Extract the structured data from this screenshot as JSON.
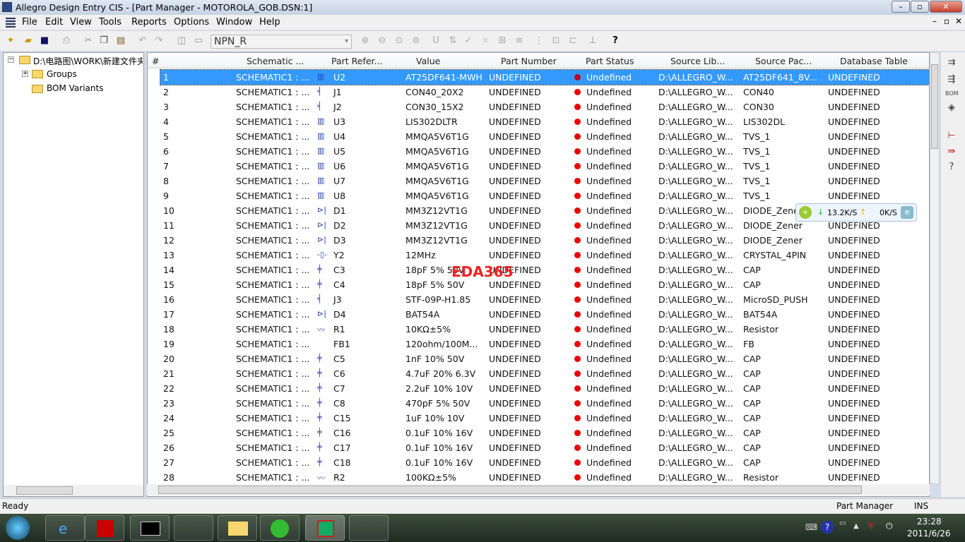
{
  "window": {
    "title": "Allegro Design Entry CIS - [Part Manager - MOTOROLA_GOB.DSN:1]"
  },
  "menu": [
    "File",
    "Edit",
    "View",
    "Tools",
    "Reports",
    "Options",
    "Window",
    "Help"
  ],
  "toolbar": {
    "combo_value": "NPN_R"
  },
  "tree": {
    "root": "D:\\电路图\\WORK\\新建文件夹",
    "children": [
      "Groups",
      "BOM Variants"
    ]
  },
  "columns": [
    "#",
    "Schematic ...",
    "Part Refer...",
    "Value",
    "Part Number",
    "Part Status",
    "Source Lib...",
    "Source Pac...",
    "Database Table"
  ],
  "rows": [
    [
      "1",
      "SCHEMATIC1 : ...",
      "ic",
      "U2",
      "AT25DF641-MWH",
      "UNDEFINED",
      "Undefined",
      "D:\\ALLEGRO_W...",
      "AT25DF641_8V...",
      "UNDEFINED"
    ],
    [
      "2",
      "SCHEMATIC1 : ...",
      "conn",
      "J1",
      "CON40_20X2",
      "UNDEFINED",
      "Undefined",
      "D:\\ALLEGRO_W...",
      "CON40",
      "UNDEFINED"
    ],
    [
      "3",
      "SCHEMATIC1 : ...",
      "conn",
      "J2",
      "CON30_15X2",
      "UNDEFINED",
      "Undefined",
      "D:\\ALLEGRO_W...",
      "CON30",
      "UNDEFINED"
    ],
    [
      "4",
      "SCHEMATIC1 : ...",
      "ic",
      "U3",
      "LIS302DLTR",
      "UNDEFINED",
      "Undefined",
      "D:\\ALLEGRO_W...",
      "LIS302DL",
      "UNDEFINED"
    ],
    [
      "5",
      "SCHEMATIC1 : ...",
      "ic",
      "U4",
      "MMQA5V6T1G",
      "UNDEFINED",
      "Undefined",
      "D:\\ALLEGRO_W...",
      "TVS_1",
      "UNDEFINED"
    ],
    [
      "6",
      "SCHEMATIC1 : ...",
      "ic",
      "U5",
      "MMQA5V6T1G",
      "UNDEFINED",
      "Undefined",
      "D:\\ALLEGRO_W...",
      "TVS_1",
      "UNDEFINED"
    ],
    [
      "7",
      "SCHEMATIC1 : ...",
      "ic",
      "U6",
      "MMQA5V6T1G",
      "UNDEFINED",
      "Undefined",
      "D:\\ALLEGRO_W...",
      "TVS_1",
      "UNDEFINED"
    ],
    [
      "8",
      "SCHEMATIC1 : ...",
      "ic",
      "U7",
      "MMQA5V6T1G",
      "UNDEFINED",
      "Undefined",
      "D:\\ALLEGRO_W...",
      "TVS_1",
      "UNDEFINED"
    ],
    [
      "9",
      "SCHEMATIC1 : ...",
      "ic",
      "U8",
      "MMQA5V6T1G",
      "UNDEFINED",
      "Undefined",
      "D:\\ALLEGRO_W...",
      "TVS_1",
      "UNDEFINED"
    ],
    [
      "10",
      "SCHEMATIC1 : ...",
      "diode",
      "D1",
      "MM3Z12VT1G",
      "UNDEFINED",
      "Undefined",
      "D:\\ALLEGRO_W...",
      "DIODE_Zener",
      "UNDEFINED"
    ],
    [
      "11",
      "SCHEMATIC1 : ...",
      "diode",
      "D2",
      "MM3Z12VT1G",
      "UNDEFINED",
      "Undefined",
      "D:\\ALLEGRO_W...",
      "DIODE_Zener",
      "UNDEFINED"
    ],
    [
      "12",
      "SCHEMATIC1 : ...",
      "diode",
      "D3",
      "MM3Z12VT1G",
      "UNDEFINED",
      "Undefined",
      "D:\\ALLEGRO_W...",
      "DIODE_Zener",
      "UNDEFINED"
    ],
    [
      "13",
      "SCHEMATIC1 : ...",
      "crystal",
      "Y2",
      "12MHz",
      "UNDEFINED",
      "Undefined",
      "D:\\ALLEGRO_W...",
      "CRYSTAL_4PIN",
      "UNDEFINED"
    ],
    [
      "14",
      "SCHEMATIC1 : ...",
      "cap",
      "C3",
      "18pF 5% 50V",
      "UNDEFINED",
      "Undefined",
      "D:\\ALLEGRO_W...",
      "CAP",
      "UNDEFINED"
    ],
    [
      "15",
      "SCHEMATIC1 : ...",
      "cap",
      "C4",
      "18pF 5% 50V",
      "UNDEFINED",
      "Undefined",
      "D:\\ALLEGRO_W...",
      "CAP",
      "UNDEFINED"
    ],
    [
      "16",
      "SCHEMATIC1 : ...",
      "conn",
      "J3",
      "STF-09P-H1.85",
      "UNDEFINED",
      "Undefined",
      "D:\\ALLEGRO_W...",
      "MicroSD_PUSH",
      "UNDEFINED"
    ],
    [
      "17",
      "SCHEMATIC1 : ...",
      "diode",
      "D4",
      "BAT54A",
      "UNDEFINED",
      "Undefined",
      "D:\\ALLEGRO_W...",
      "BAT54A",
      "UNDEFINED"
    ],
    [
      "18",
      "SCHEMATIC1 : ...",
      "res",
      "R1",
      "10KΩ±5%",
      "UNDEFINED",
      "Undefined",
      "D:\\ALLEGRO_W...",
      "Resistor",
      "UNDEFINED"
    ],
    [
      "19",
      "SCHEMATIC1 : ...",
      "none",
      "FB1",
      "120ohm/100M...",
      "UNDEFINED",
      "Undefined",
      "D:\\ALLEGRO_W...",
      "FB",
      "UNDEFINED"
    ],
    [
      "20",
      "SCHEMATIC1 : ...",
      "cap",
      "C5",
      "1nF 10% 50V",
      "UNDEFINED",
      "Undefined",
      "D:\\ALLEGRO_W...",
      "CAP",
      "UNDEFINED"
    ],
    [
      "21",
      "SCHEMATIC1 : ...",
      "cap",
      "C6",
      "4.7uF 20% 6.3V",
      "UNDEFINED",
      "Undefined",
      "D:\\ALLEGRO_W...",
      "CAP",
      "UNDEFINED"
    ],
    [
      "22",
      "SCHEMATIC1 : ...",
      "cap",
      "C7",
      "2.2uF 10% 10V",
      "UNDEFINED",
      "Undefined",
      "D:\\ALLEGRO_W...",
      "CAP",
      "UNDEFINED"
    ],
    [
      "23",
      "SCHEMATIC1 : ...",
      "cap",
      "C8",
      "470pF 5% 50V",
      "UNDEFINED",
      "Undefined",
      "D:\\ALLEGRO_W...",
      "CAP",
      "UNDEFINED"
    ],
    [
      "24",
      "SCHEMATIC1 : ...",
      "cap",
      "C15",
      "1uF 10% 10V",
      "UNDEFINED",
      "Undefined",
      "D:\\ALLEGRO_W...",
      "CAP",
      "UNDEFINED"
    ],
    [
      "25",
      "SCHEMATIC1 : ...",
      "cap",
      "C16",
      "0.1uF 10% 16V",
      "UNDEFINED",
      "Undefined",
      "D:\\ALLEGRO_W...",
      "CAP",
      "UNDEFINED"
    ],
    [
      "26",
      "SCHEMATIC1 : ...",
      "cap",
      "C17",
      "0.1uF 10% 16V",
      "UNDEFINED",
      "Undefined",
      "D:\\ALLEGRO_W...",
      "CAP",
      "UNDEFINED"
    ],
    [
      "27",
      "SCHEMATIC1 : ...",
      "cap",
      "C18",
      "0.1uF 10% 16V",
      "UNDEFINED",
      "Undefined",
      "D:\\ALLEGRO_W...",
      "CAP",
      "UNDEFINED"
    ],
    [
      "28",
      "SCHEMATIC1 : ...",
      "res",
      "R2",
      "100KΩ±5%",
      "UNDEFINED",
      "Undefined",
      "D:\\ALLEGRO_W...",
      "Resistor",
      "UNDEFINED"
    ]
  ],
  "watermark": "EDA365",
  "net_widget": {
    "down": "13.2K/S",
    "up": "0K/S"
  },
  "status": {
    "left": "Ready",
    "mode": "Part Manager",
    "ins": "INS"
  },
  "clock": {
    "time": "23:28",
    "date": "2011/6/26"
  }
}
